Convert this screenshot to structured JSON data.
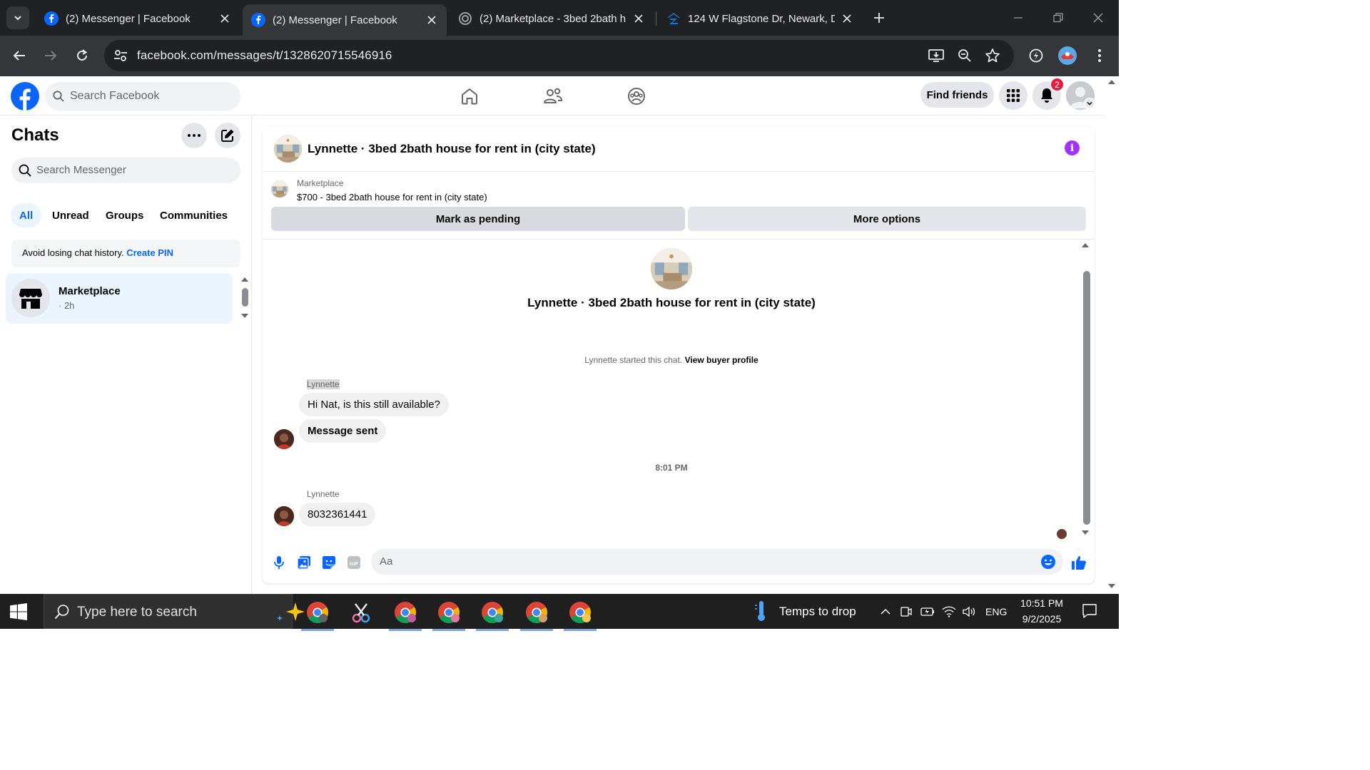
{
  "browser": {
    "tabs": [
      {
        "title": "(2) Messenger | Facebook",
        "icon": "facebook-icon",
        "active": false
      },
      {
        "title": "(2) Messenger | Facebook",
        "icon": "facebook-icon",
        "active": true
      },
      {
        "title": "(2) Marketplace - 3bed 2bath h",
        "icon": "loading-icon",
        "active": false
      },
      {
        "title": "124 W Flagstone Dr, Newark, D",
        "icon": "zillow-icon",
        "active": false
      }
    ],
    "url": "facebook.com/messages/t/1328620715546916"
  },
  "fb_header": {
    "search_placeholder": "Search Facebook",
    "find_friends_label": "Find friends",
    "notification_count": "2"
  },
  "sidebar": {
    "title": "Chats",
    "search_placeholder": "Search Messenger",
    "filters": [
      "All",
      "Unread",
      "Groups",
      "Communities"
    ],
    "active_filter": "All",
    "pin_banner": {
      "text": "Avoid losing chat history. ",
      "link": "Create PIN"
    },
    "chats": [
      {
        "name": "Marketplace",
        "time": "· 2h"
      }
    ]
  },
  "conversation": {
    "title": "Lynnette · 3bed 2bath house for rent in (city state)",
    "marketplace": {
      "label": "Marketplace",
      "listing": "$700 - 3bed 2bath house for rent in (city state)",
      "mark_pending_label": "Mark as pending",
      "more_options_label": "More options"
    },
    "intro_title": "Lynnette · 3bed 2bath house for rent in (city state)",
    "started_text": "Lynnette started this chat. ",
    "view_profile_link": "View buyer profile",
    "messages": [
      {
        "sender": "Lynnette",
        "text": "Hi Nat, is this still available?"
      },
      {
        "sender": "",
        "text": "Message sent"
      },
      {
        "timestamp": "8:01 PM"
      },
      {
        "sender": "Lynnette",
        "text": "8032361441"
      }
    ],
    "composer_placeholder": "Aa"
  },
  "taskbar": {
    "search_placeholder": "Type here to search",
    "weather_text": "Temps to drop",
    "language": "ENG",
    "time": "10:51 PM",
    "date": "9/2/2025"
  },
  "colors": {
    "fb_blue": "#0866ff",
    "messenger_purple": "#a033ff",
    "notification_red": "#e41e3f",
    "chrome_dark": "#202124",
    "chrome_toolbar": "#35363a"
  }
}
